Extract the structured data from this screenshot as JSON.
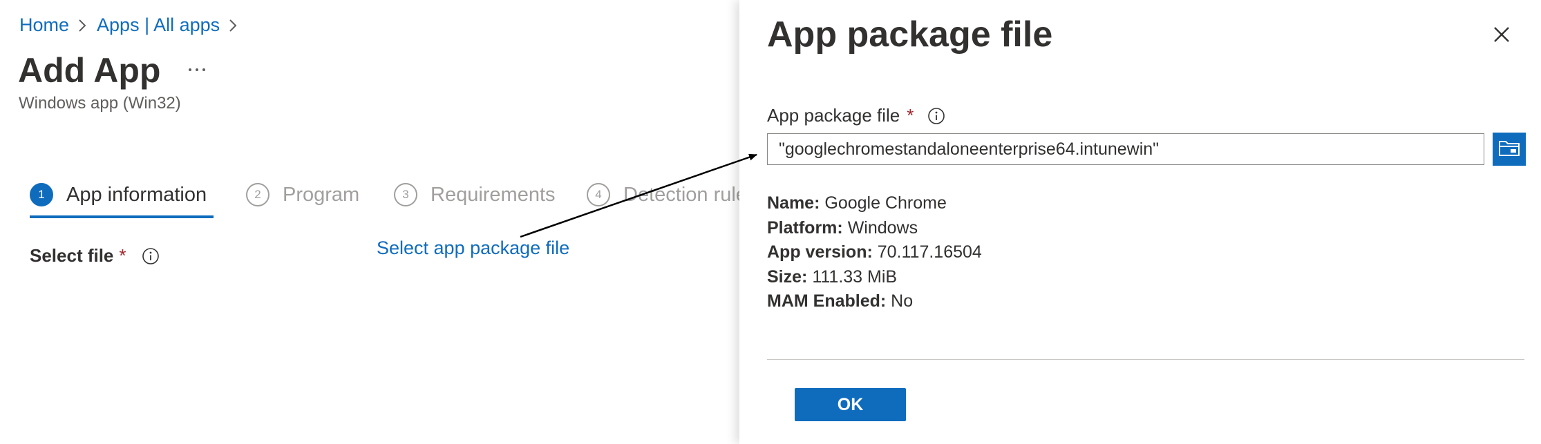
{
  "breadcrumb": {
    "items": [
      "Home",
      "Apps | All apps"
    ]
  },
  "page": {
    "title": "Add App",
    "more_label": "...",
    "subtitle": "Windows app (Win32)"
  },
  "wizard": {
    "steps": [
      {
        "number": "1",
        "label": "App information",
        "state": "active"
      },
      {
        "number": "2",
        "label": "Program",
        "state": "inactive"
      },
      {
        "number": "3",
        "label": "Requirements",
        "state": "inactive"
      },
      {
        "number": "4",
        "label": "Detection rule",
        "state": "inactive"
      }
    ]
  },
  "form": {
    "select_file_label": "Select file",
    "required_marker": "*",
    "select_package_link": "Select app package file"
  },
  "panel": {
    "title": "App package file",
    "field_label": "App package file",
    "required_marker": "*",
    "file_value": "\"googlechromestandaloneenterprise64.intunewin\"",
    "details": [
      {
        "key": "Name:",
        "value": "Google Chrome"
      },
      {
        "key": "Platform:",
        "value": "Windows"
      },
      {
        "key": "App version:",
        "value": "70.117.16504"
      },
      {
        "key": "Size:",
        "value": "111.33 MiB"
      },
      {
        "key": "MAM Enabled:",
        "value": "No"
      }
    ],
    "ok_label": "OK"
  },
  "icons": {
    "breadcrumb_separator": "chevron-right-icon",
    "more": "more-icon",
    "info": "info-icon",
    "close": "close-icon",
    "browse": "folder-icon"
  },
  "colors": {
    "accent": "#0f6cbd",
    "required": "#a4262c",
    "text": "#323130",
    "muted": "#a19f9d"
  }
}
